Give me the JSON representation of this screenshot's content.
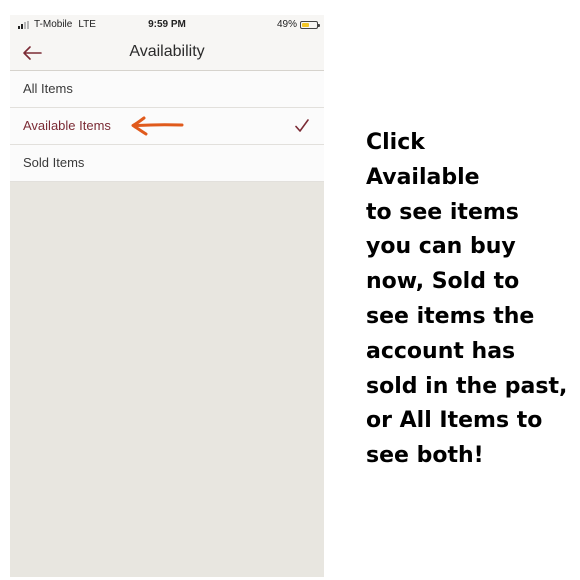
{
  "status_bar": {
    "carrier": "T-Mobile",
    "network": "LTE",
    "time": "9:59 PM",
    "battery": "49%",
    "battery_level": 0.49,
    "battery_color": "#f3c626"
  },
  "nav": {
    "back_icon": "arrow-left-icon",
    "title": "Availability"
  },
  "options": [
    {
      "label": "All Items",
      "selected": false
    },
    {
      "label": "Available Items",
      "selected": true
    },
    {
      "label": "Sold Items",
      "selected": false
    }
  ],
  "selected_icon": "checkmark-icon",
  "annotation": {
    "arrow_icon": "hand-drawn-arrow-left-icon",
    "arrow_color": "#e05a1c",
    "lines": [
      "Click",
      "Available",
      "to see items",
      "you can buy",
      "now, Sold to",
      "see items the",
      "account has",
      "sold in the past,",
      "or All Items to",
      "see both!"
    ]
  },
  "colors": {
    "accent": "#7b2b35",
    "background": "#e8e6e0"
  }
}
